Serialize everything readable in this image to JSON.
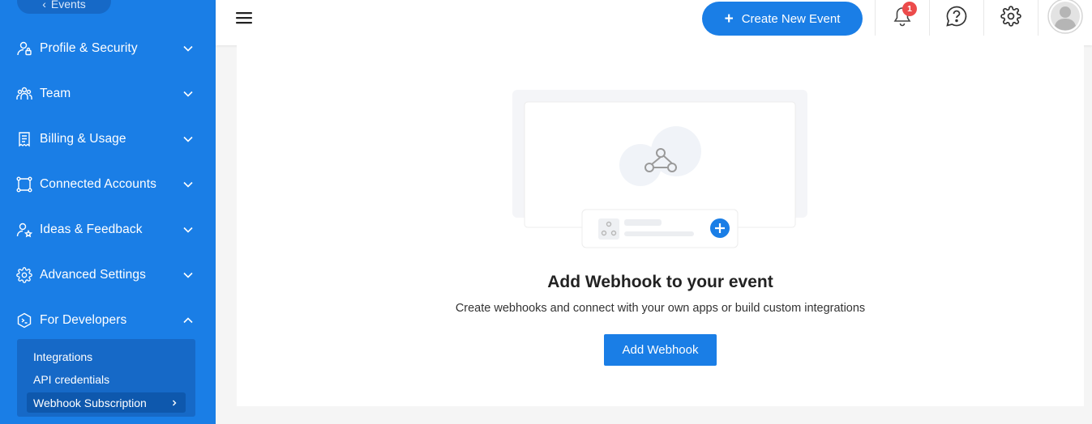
{
  "sidebar": {
    "back_label": "Events",
    "items": [
      {
        "label": "Profile & Security"
      },
      {
        "label": "Team"
      },
      {
        "label": "Billing & Usage"
      },
      {
        "label": "Connected Accounts"
      },
      {
        "label": "Ideas & Feedback"
      },
      {
        "label": "Advanced Settings"
      },
      {
        "label": "For Developers"
      }
    ],
    "sub_items": [
      {
        "label": "Integrations"
      },
      {
        "label": "API credentials"
      },
      {
        "label": "Webhook Subscription"
      }
    ]
  },
  "topbar": {
    "create_label": "Create New Event",
    "notification_count": "1"
  },
  "main": {
    "empty_title": "Add Webhook to your event",
    "empty_subtitle": "Create webhooks and connect with your own apps or build custom integrations",
    "add_button": "Add Webhook"
  },
  "colors": {
    "brand": "#1a7ee6",
    "sidebar_sub": "#1669c7",
    "badge": "#ec4b4b"
  }
}
